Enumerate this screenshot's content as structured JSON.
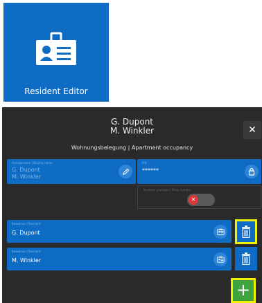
{
  "app_tile": {
    "label": "Resident Editor",
    "icon": "id-badge-icon",
    "bg_color": "#0e6cc4"
  },
  "dialog": {
    "title_line1": "G. Dupont",
    "title_line2": "M. Winkler",
    "subtitle": "Wohnungsbelegung | Apartment occupancy",
    "close_label": "✕",
    "display_name": {
      "caption": "Anzeigename | Display name",
      "line1": "G. Dupont",
      "line2": "M. Winkler",
      "edit_icon": "pencil-icon"
    },
    "pin": {
      "caption": "PIN",
      "value": "******",
      "lock_icon": "lock-icon"
    },
    "toggle": {
      "caption": "Nummer anzeigen | Show number",
      "state": "off"
    },
    "residents": [
      {
        "caption": "Bewohner | Resident",
        "name": "G. Dupont"
      },
      {
        "caption": "Bewohner | Resident",
        "name": "M. Winkler"
      }
    ],
    "add_label": "+",
    "colors": {
      "dialog_bg": "#2a2a2a",
      "accent_blue": "#0e6cc4",
      "highlight": "#f0f000",
      "add_green": "#3fa43f",
      "toggle_red": "#d9383a"
    }
  }
}
